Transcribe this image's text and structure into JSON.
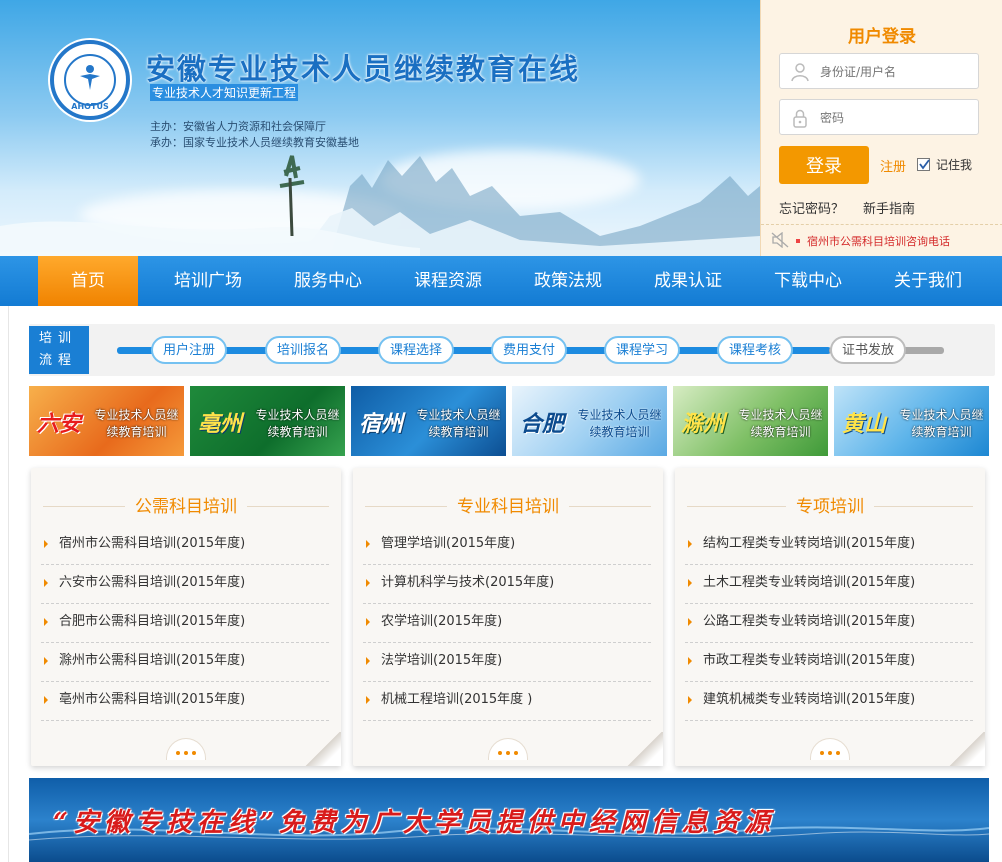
{
  "header": {
    "site_title": "安徽专业技术人员继续教育在线",
    "subtitle": "专业技术人才知识更新工程",
    "sponsor": "主办：安徽省人力资源和社会保障厅",
    "organizer": "承办：国家专业技术人员继续教育安徽基地",
    "logo_text": "AHOTUS"
  },
  "login": {
    "title": "用户登录",
    "username_placeholder": "身份证/用户名",
    "password_placeholder": "密码",
    "login_button": "登录",
    "register_link": "注册",
    "remember_label": "记住我",
    "forgot_link": "忘记密码？",
    "guide_link": "新手指南",
    "notice": "宿州市公需科目培训咨询电话"
  },
  "nav": {
    "items": [
      "首页",
      "培训广场",
      "服务中心",
      "课程资源",
      "政策法规",
      "成果认证",
      "下载中心",
      "关于我们"
    ]
  },
  "flow": {
    "label": "培训流程",
    "steps": [
      "用户注册",
      "培训报名",
      "课程选择",
      "费用支付",
      "课程学习",
      "课程考核",
      "证书发放"
    ]
  },
  "cities": [
    {
      "name": "六安",
      "desc": "专业技术人员继续教育培训"
    },
    {
      "name": "亳州",
      "desc": "专业技术人员继续教育培训"
    },
    {
      "name": "宿州",
      "desc": "专业技术人员继续教育培训"
    },
    {
      "name": "合肥",
      "desc": "专业技术人员继续教育培训"
    },
    {
      "name": "滁州",
      "desc": "专业技术人员继续教育培训"
    },
    {
      "name": "黄山",
      "desc": "专业技术人员继续教育培训"
    }
  ],
  "panels": [
    {
      "title": "公需科目培训",
      "items": [
        "宿州市公需科目培训(2015年度)",
        "六安市公需科目培训(2015年度)",
        "合肥市公需科目培训(2015年度)",
        "滁州市公需科目培训(2015年度)",
        "亳州市公需科目培训(2015年度)"
      ]
    },
    {
      "title": "专业科目培训",
      "items": [
        "管理学培训(2015年度)",
        "计算机科学与技术(2015年度)",
        "农学培训(2015年度)",
        "法学培训(2015年度)",
        "机械工程培训(2015年度 )"
      ]
    },
    {
      "title": "专项培训",
      "items": [
        "结构工程类专业转岗培训(2015年度)",
        "土木工程类专业转岗培训(2015年度)",
        "公路工程类专业转岗培训(2015年度)",
        "市政工程类专业转岗培训(2015年度)",
        "建筑机械类专业转岗培训(2015年度)"
      ]
    }
  ],
  "bottom_banner": {
    "text": "“安徽专技在线”免费为广大学员提供中经网信息资源"
  },
  "colors": {
    "primary_blue": "#1a7fd4",
    "accent_orange": "#f39800",
    "notice_red": "#d42a2a"
  }
}
